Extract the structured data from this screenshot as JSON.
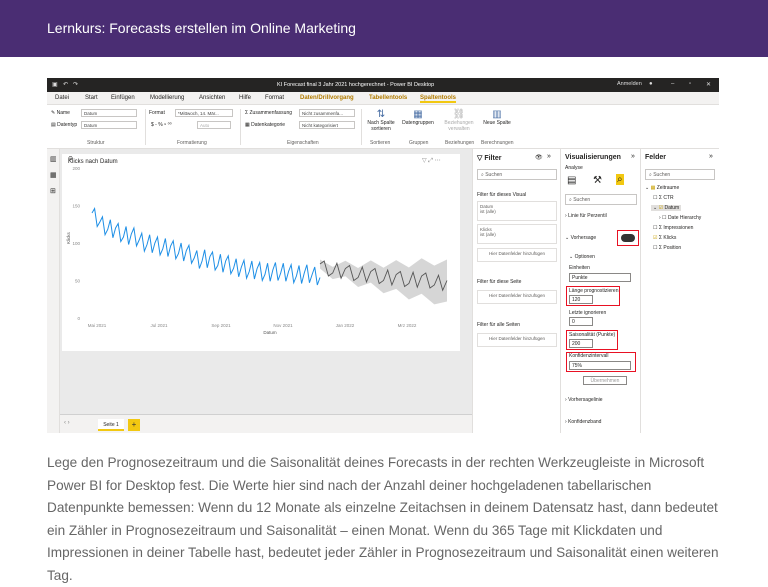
{
  "header": {
    "title": "Lernkurs: Forecasts erstellen im Online Marketing"
  },
  "window": {
    "title": "KI Forecast final 3 Jahr 2021 hochgerechnet - Power BI Desktop",
    "signin": "Anmelden"
  },
  "menu": [
    "Datei",
    "Start",
    "Einfügen",
    "Modellierung",
    "Ansichten",
    "Hilfe",
    "Format",
    "Daten/Drillvorgang",
    "Tabellentools",
    "Spaltentools"
  ],
  "ribbon": {
    "name_label": "Name",
    "name_value": "Datum",
    "datatype_label": "Datentyp",
    "datatype_value": "Datum",
    "format_label": "Format",
    "format_value": "*Mittwoch, 14. Mär...",
    "format_symbols": "$ - % ⁹ ⁰⁰",
    "auto_value": "Auto",
    "summary_label": "Zusammenfassung",
    "summary_value": "Nicht zusammenfa...",
    "category_label": "Datenkategorie",
    "category_value": "Nicht kategorisiert",
    "sort_label": "Nach Spalte sortieren",
    "groups_label": "Datengruppen",
    "relations_label": "Beziehungen verwalten",
    "newcol_label": "Neue Spalte",
    "groups": [
      "Struktur",
      "Formatierung",
      "Eigenschaften",
      "Sortieren",
      "Gruppen",
      "Beziehungen",
      "Berechnungen"
    ]
  },
  "chart": {
    "title": "Klicks nach Datum",
    "ylabel": "Klicks",
    "xlabel": "Datum"
  },
  "chart_data": {
    "type": "line",
    "title": "Klicks nach Datum",
    "xlabel": "Datum",
    "ylabel": "Klicks",
    "ylim": [
      0,
      200
    ],
    "yticks": [
      "200",
      "150",
      "100",
      "50",
      "0"
    ],
    "xticks": [
      "Mai 2021",
      "Jul 2021",
      "Sep 2021",
      "Nov 2021",
      "Jan 2022",
      "Mrz 2022"
    ],
    "series": [
      {
        "name": "Klicks",
        "color": "#1e8fe6",
        "values": [
          140,
          128,
          118,
          120,
          108,
          112,
          104,
          98,
          100,
          92,
          96,
          86,
          90,
          80,
          76,
          82,
          70,
          76,
          66,
          68,
          62,
          66,
          58,
          64,
          60,
          62,
          56,
          60,
          58,
          54
        ]
      },
      {
        "name": "Prognose",
        "color": "#555555",
        "values": [
          72,
          60,
          66,
          54,
          62,
          50,
          58,
          46,
          56,
          44,
          50
        ]
      }
    ],
    "confidence_band": "75%"
  },
  "filter": {
    "title": "Filter",
    "search": "Suchen",
    "section_visual": "Filter für dieses Visual",
    "card1_name": "Datum",
    "card1_value": "ist (alle)",
    "card2_name": "Klicks",
    "card2_value": "ist (alle)",
    "add_btn": "Hier Datenfelder hinzufügen",
    "section_page": "Filter für diese Seite",
    "section_all": "Filter für alle Seiten"
  },
  "viz": {
    "title": "Visualisierungen",
    "analysis": "Analyse",
    "search": "Suchen",
    "percentile": "Linie für Perzentil",
    "forecast": "Vorhersage",
    "options": "Optionen",
    "units_label": "Einheiten",
    "units_value": "Punkte",
    "length_label": "Länge prognostizieren",
    "length_value": "120",
    "ignore_label": "Letzte ignorieren",
    "ignore_value": "0",
    "season_label": "Saisonalität (Punkte)",
    "season_value": "200",
    "conf_label": "Konfidenzintervall",
    "conf_value": "75%",
    "apply": "Übernehmen",
    "forecast_line": "Vorhersagelinie",
    "conf_band": "Konfidenzband"
  },
  "fields": {
    "title": "Felder",
    "search": "Suchen",
    "table": "Zeitraume",
    "items": [
      "CTR",
      "Datum",
      "Date Hierarchy",
      "Impressionen",
      "Klicks",
      "Position"
    ]
  },
  "page_tab": "Seite 1",
  "caption": "Lege den Prognosezeitraum und die Saisonalität deines Forecasts in der rechten Werkzeugleiste in Microsoft Power BI for Desktop fest. Die Werte hier sind nach der Anzahl deiner hochgeladenen tabellarischen Datenpunkte bemessen: Wenn du 12 Monate als einzelne Zeitachsen in deinem Datensatz hast, dann bedeutet ein Zähler in Prognosezeitraum und Saisonalität – einen Monat. Wenn du 365 Tage mit Klickdaten und Impressionen in deiner Tabelle hast, bedeutet jeder Zähler in Prognosezeitraum und Saisonalität einen weiteren Tag."
}
